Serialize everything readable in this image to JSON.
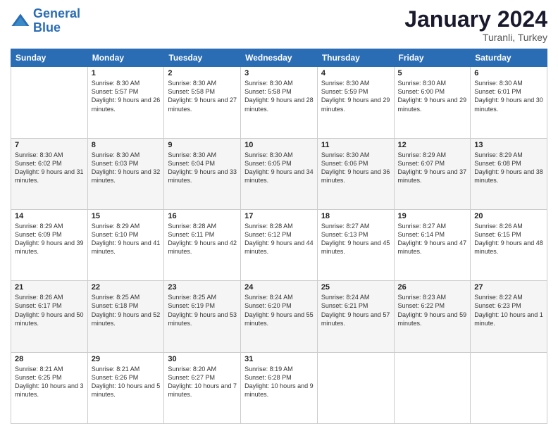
{
  "logo": {
    "line1": "General",
    "line2": "Blue"
  },
  "header": {
    "month": "January 2024",
    "location": "Turanli, Turkey"
  },
  "weekdays": [
    "Sunday",
    "Monday",
    "Tuesday",
    "Wednesday",
    "Thursday",
    "Friday",
    "Saturday"
  ],
  "weeks": [
    [
      {
        "day": "",
        "sunrise": "",
        "sunset": "",
        "daylight": ""
      },
      {
        "day": "1",
        "sunrise": "Sunrise: 8:30 AM",
        "sunset": "Sunset: 5:57 PM",
        "daylight": "Daylight: 9 hours and 26 minutes."
      },
      {
        "day": "2",
        "sunrise": "Sunrise: 8:30 AM",
        "sunset": "Sunset: 5:58 PM",
        "daylight": "Daylight: 9 hours and 27 minutes."
      },
      {
        "day": "3",
        "sunrise": "Sunrise: 8:30 AM",
        "sunset": "Sunset: 5:58 PM",
        "daylight": "Daylight: 9 hours and 28 minutes."
      },
      {
        "day": "4",
        "sunrise": "Sunrise: 8:30 AM",
        "sunset": "Sunset: 5:59 PM",
        "daylight": "Daylight: 9 hours and 29 minutes."
      },
      {
        "day": "5",
        "sunrise": "Sunrise: 8:30 AM",
        "sunset": "Sunset: 6:00 PM",
        "daylight": "Daylight: 9 hours and 29 minutes."
      },
      {
        "day": "6",
        "sunrise": "Sunrise: 8:30 AM",
        "sunset": "Sunset: 6:01 PM",
        "daylight": "Daylight: 9 hours and 30 minutes."
      }
    ],
    [
      {
        "day": "7",
        "sunrise": "Sunrise: 8:30 AM",
        "sunset": "Sunset: 6:02 PM",
        "daylight": "Daylight: 9 hours and 31 minutes."
      },
      {
        "day": "8",
        "sunrise": "Sunrise: 8:30 AM",
        "sunset": "Sunset: 6:03 PM",
        "daylight": "Daylight: 9 hours and 32 minutes."
      },
      {
        "day": "9",
        "sunrise": "Sunrise: 8:30 AM",
        "sunset": "Sunset: 6:04 PM",
        "daylight": "Daylight: 9 hours and 33 minutes."
      },
      {
        "day": "10",
        "sunrise": "Sunrise: 8:30 AM",
        "sunset": "Sunset: 6:05 PM",
        "daylight": "Daylight: 9 hours and 34 minutes."
      },
      {
        "day": "11",
        "sunrise": "Sunrise: 8:30 AM",
        "sunset": "Sunset: 6:06 PM",
        "daylight": "Daylight: 9 hours and 36 minutes."
      },
      {
        "day": "12",
        "sunrise": "Sunrise: 8:29 AM",
        "sunset": "Sunset: 6:07 PM",
        "daylight": "Daylight: 9 hours and 37 minutes."
      },
      {
        "day": "13",
        "sunrise": "Sunrise: 8:29 AM",
        "sunset": "Sunset: 6:08 PM",
        "daylight": "Daylight: 9 hours and 38 minutes."
      }
    ],
    [
      {
        "day": "14",
        "sunrise": "Sunrise: 8:29 AM",
        "sunset": "Sunset: 6:09 PM",
        "daylight": "Daylight: 9 hours and 39 minutes."
      },
      {
        "day": "15",
        "sunrise": "Sunrise: 8:29 AM",
        "sunset": "Sunset: 6:10 PM",
        "daylight": "Daylight: 9 hours and 41 minutes."
      },
      {
        "day": "16",
        "sunrise": "Sunrise: 8:28 AM",
        "sunset": "Sunset: 6:11 PM",
        "daylight": "Daylight: 9 hours and 42 minutes."
      },
      {
        "day": "17",
        "sunrise": "Sunrise: 8:28 AM",
        "sunset": "Sunset: 6:12 PM",
        "daylight": "Daylight: 9 hours and 44 minutes."
      },
      {
        "day": "18",
        "sunrise": "Sunrise: 8:27 AM",
        "sunset": "Sunset: 6:13 PM",
        "daylight": "Daylight: 9 hours and 45 minutes."
      },
      {
        "day": "19",
        "sunrise": "Sunrise: 8:27 AM",
        "sunset": "Sunset: 6:14 PM",
        "daylight": "Daylight: 9 hours and 47 minutes."
      },
      {
        "day": "20",
        "sunrise": "Sunrise: 8:26 AM",
        "sunset": "Sunset: 6:15 PM",
        "daylight": "Daylight: 9 hours and 48 minutes."
      }
    ],
    [
      {
        "day": "21",
        "sunrise": "Sunrise: 8:26 AM",
        "sunset": "Sunset: 6:17 PM",
        "daylight": "Daylight: 9 hours and 50 minutes."
      },
      {
        "day": "22",
        "sunrise": "Sunrise: 8:25 AM",
        "sunset": "Sunset: 6:18 PM",
        "daylight": "Daylight: 9 hours and 52 minutes."
      },
      {
        "day": "23",
        "sunrise": "Sunrise: 8:25 AM",
        "sunset": "Sunset: 6:19 PM",
        "daylight": "Daylight: 9 hours and 53 minutes."
      },
      {
        "day": "24",
        "sunrise": "Sunrise: 8:24 AM",
        "sunset": "Sunset: 6:20 PM",
        "daylight": "Daylight: 9 hours and 55 minutes."
      },
      {
        "day": "25",
        "sunrise": "Sunrise: 8:24 AM",
        "sunset": "Sunset: 6:21 PM",
        "daylight": "Daylight: 9 hours and 57 minutes."
      },
      {
        "day": "26",
        "sunrise": "Sunrise: 8:23 AM",
        "sunset": "Sunset: 6:22 PM",
        "daylight": "Daylight: 9 hours and 59 minutes."
      },
      {
        "day": "27",
        "sunrise": "Sunrise: 8:22 AM",
        "sunset": "Sunset: 6:23 PM",
        "daylight": "Daylight: 10 hours and 1 minute."
      }
    ],
    [
      {
        "day": "28",
        "sunrise": "Sunrise: 8:21 AM",
        "sunset": "Sunset: 6:25 PM",
        "daylight": "Daylight: 10 hours and 3 minutes."
      },
      {
        "day": "29",
        "sunrise": "Sunrise: 8:21 AM",
        "sunset": "Sunset: 6:26 PM",
        "daylight": "Daylight: 10 hours and 5 minutes."
      },
      {
        "day": "30",
        "sunrise": "Sunrise: 8:20 AM",
        "sunset": "Sunset: 6:27 PM",
        "daylight": "Daylight: 10 hours and 7 minutes."
      },
      {
        "day": "31",
        "sunrise": "Sunrise: 8:19 AM",
        "sunset": "Sunset: 6:28 PM",
        "daylight": "Daylight: 10 hours and 9 minutes."
      },
      {
        "day": "",
        "sunrise": "",
        "sunset": "",
        "daylight": ""
      },
      {
        "day": "",
        "sunrise": "",
        "sunset": "",
        "daylight": ""
      },
      {
        "day": "",
        "sunrise": "",
        "sunset": "",
        "daylight": ""
      }
    ]
  ]
}
